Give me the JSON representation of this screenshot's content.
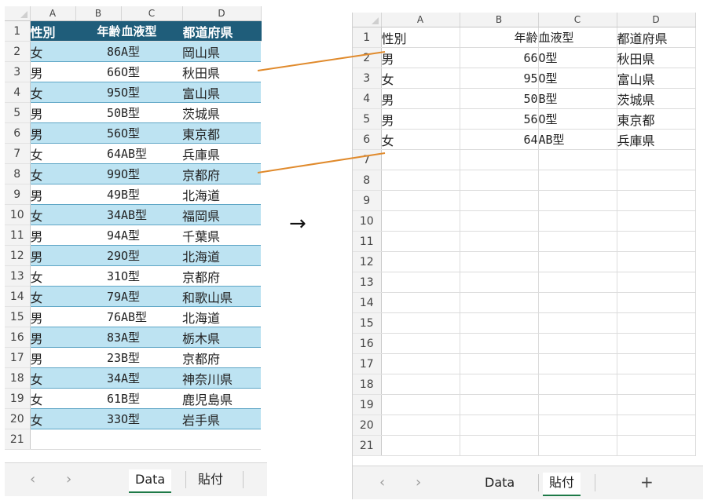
{
  "columns": [
    "A",
    "B",
    "C",
    "D"
  ],
  "data_sheet": {
    "header": [
      "性別",
      "年齢",
      "血液型",
      "都道府県"
    ],
    "rows": [
      [
        "女",
        "86",
        "A型",
        "岡山県"
      ],
      [
        "男",
        "66",
        "O型",
        "秋田県"
      ],
      [
        "女",
        "95",
        "O型",
        "富山県"
      ],
      [
        "男",
        "50",
        "B型",
        "茨城県"
      ],
      [
        "男",
        "56",
        "O型",
        "東京都"
      ],
      [
        "女",
        "64",
        "AB型",
        "兵庫県"
      ],
      [
        "女",
        "99",
        "O型",
        "京都府"
      ],
      [
        "男",
        "49",
        "B型",
        "北海道"
      ],
      [
        "女",
        "34",
        "AB型",
        "福岡県"
      ],
      [
        "男",
        "94",
        "A型",
        "千葉県"
      ],
      [
        "男",
        "29",
        "O型",
        "北海道"
      ],
      [
        "女",
        "31",
        "O型",
        "京都府"
      ],
      [
        "女",
        "79",
        "A型",
        "和歌山県"
      ],
      [
        "男",
        "76",
        "AB型",
        "北海道"
      ],
      [
        "男",
        "83",
        "A型",
        "栃木県"
      ],
      [
        "男",
        "23",
        "B型",
        "京都府"
      ],
      [
        "女",
        "34",
        "A型",
        "神奈川県"
      ],
      [
        "女",
        "61",
        "B型",
        "鹿児島県"
      ],
      [
        "女",
        "33",
        "O型",
        "岩手県"
      ]
    ],
    "row_numbers": [
      "1",
      "2",
      "3",
      "4",
      "5",
      "6",
      "7",
      "8",
      "9",
      "10",
      "11",
      "12",
      "13",
      "14",
      "15",
      "16",
      "17",
      "18",
      "19",
      "20",
      "21"
    ]
  },
  "paste_sheet": {
    "header": [
      "性別",
      "年齢",
      "血液型",
      "都道府県"
    ],
    "rows": [
      [
        "男",
        "66",
        "O型",
        "秋田県"
      ],
      [
        "女",
        "95",
        "O型",
        "富山県"
      ],
      [
        "男",
        "50",
        "B型",
        "茨城県"
      ],
      [
        "男",
        "56",
        "O型",
        "東京都"
      ],
      [
        "女",
        "64",
        "AB型",
        "兵庫県"
      ]
    ],
    "row_numbers": [
      "1",
      "2",
      "3",
      "4",
      "5",
      "6",
      "7",
      "8",
      "9",
      "10",
      "11",
      "12",
      "13",
      "14",
      "15",
      "16",
      "17",
      "18",
      "19",
      "20",
      "21"
    ]
  },
  "tabs": {
    "left": {
      "items": [
        "Data",
        "貼付"
      ],
      "active": "Data"
    },
    "right": {
      "items": [
        "Data",
        "貼付"
      ],
      "active": "貼付",
      "add": "+"
    },
    "prev": "‹",
    "next": "›"
  },
  "arrow_glyph": "→",
  "colors": {
    "header_fill": "#1f5d7a",
    "band_fill": "#bde3f2",
    "connector": "#e08a2c",
    "active_tab_underline": "#1e7a47"
  }
}
